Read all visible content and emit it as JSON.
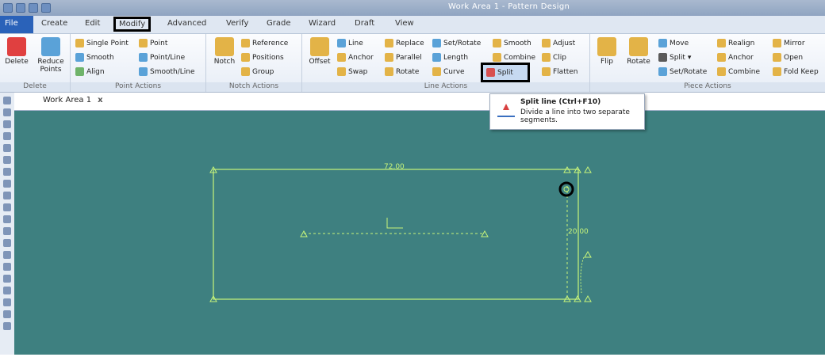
{
  "window": {
    "title": "Work Area 1 - Pattern Design"
  },
  "menu": [
    "File",
    "Create",
    "Edit",
    "Modify",
    "Advanced",
    "Verify",
    "Grade",
    "Wizard",
    "Draft",
    "View"
  ],
  "ribbon": {
    "delete_group": {
      "label": "Delete",
      "items": [
        "Delete",
        "Reduce Points"
      ]
    },
    "point_group": {
      "label": "Point Actions",
      "items": [
        "Single Point",
        "Smooth",
        "Align",
        "Point",
        "Point/Line",
        "Smooth/Line"
      ]
    },
    "notch_group": {
      "label": "Notch Actions",
      "items": [
        "Notch",
        "Reference",
        "Positions",
        "Group"
      ]
    },
    "line_group": {
      "label": "Line Actions",
      "items": [
        "Offset",
        "Line",
        "Anchor",
        "Swap",
        "Replace",
        "Parallel",
        "Rotate",
        "Set/Rotate",
        "Length",
        "Curve",
        "Smooth",
        "Combine",
        "Split",
        "Adjust",
        "Clip",
        "Flatten"
      ]
    },
    "piece_group": {
      "label": "Piece Actions",
      "items": [
        "Flip",
        "Rotate",
        "Move",
        "Split ▾",
        "Set/Rotate",
        "Realign",
        "Anchor",
        "Combine",
        "Mirror",
        "Open",
        "Fold Keep"
      ]
    }
  },
  "tooltip": {
    "title": "Split line (Ctrl+F10)",
    "desc": "Divide a line into two separate segments."
  },
  "doc_tab": {
    "label": "Work Area 1",
    "close": "x"
  },
  "canvas": {
    "dim_top": "72.00",
    "dim_right": "20.00"
  },
  "colors": {
    "canvas": "#3e8080",
    "line": "#c8f57a",
    "ribbon_tab_active": "#000000"
  }
}
